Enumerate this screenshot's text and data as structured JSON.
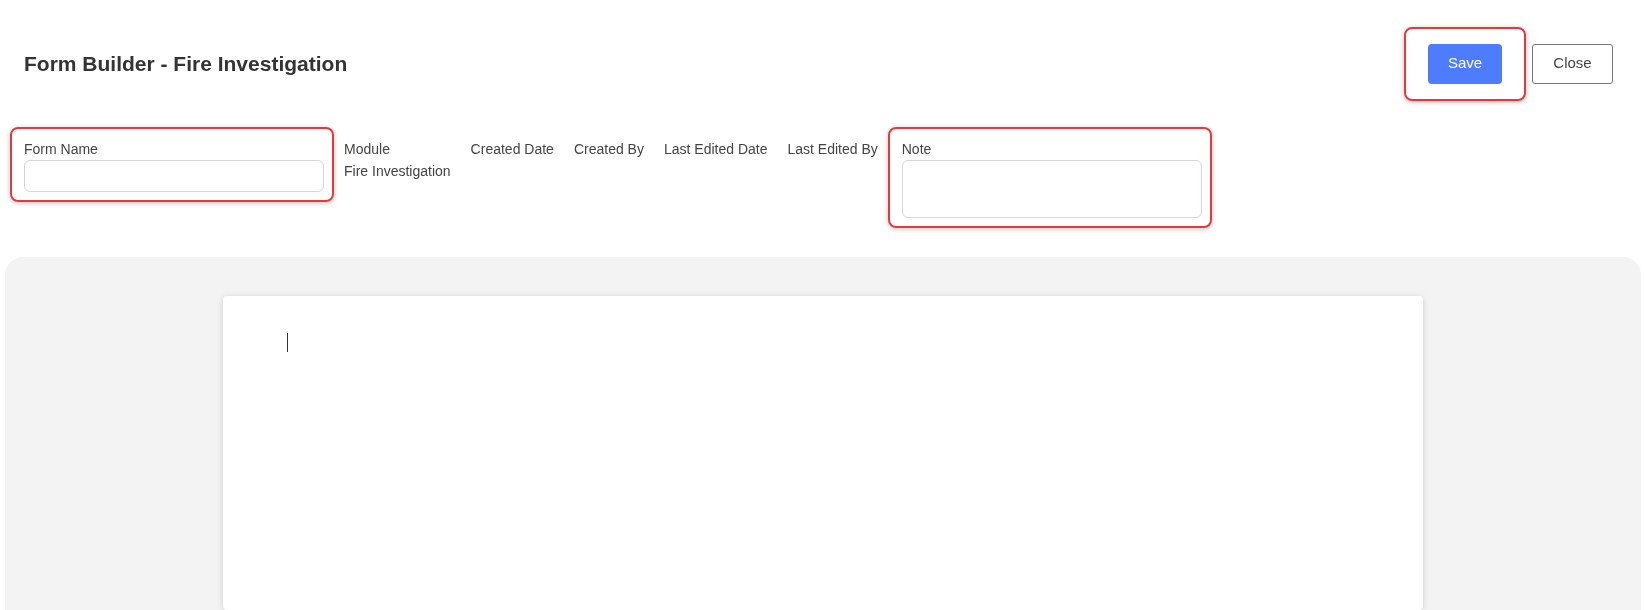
{
  "title": "Form Builder - Fire Investigation",
  "buttons": [
    {
      "kind": "primary",
      "label": "Save",
      "highlighted": true
    },
    {
      "kind": "secondary",
      "label": "Close",
      "highlighted": false
    }
  ],
  "fields": [
    {
      "kind": "input",
      "label": "Form Name",
      "highlighted": true
    },
    {
      "kind": "info",
      "label": "Module",
      "value": "Fire Investigation"
    },
    {
      "kind": "info",
      "label": "Created Date"
    },
    {
      "kind": "info",
      "label": "Created By"
    },
    {
      "kind": "info",
      "label": "Last Edited Date"
    },
    {
      "kind": "info",
      "label": "Last Edited By"
    },
    {
      "kind": "textarea",
      "label": "Note",
      "highlighted": true
    }
  ]
}
